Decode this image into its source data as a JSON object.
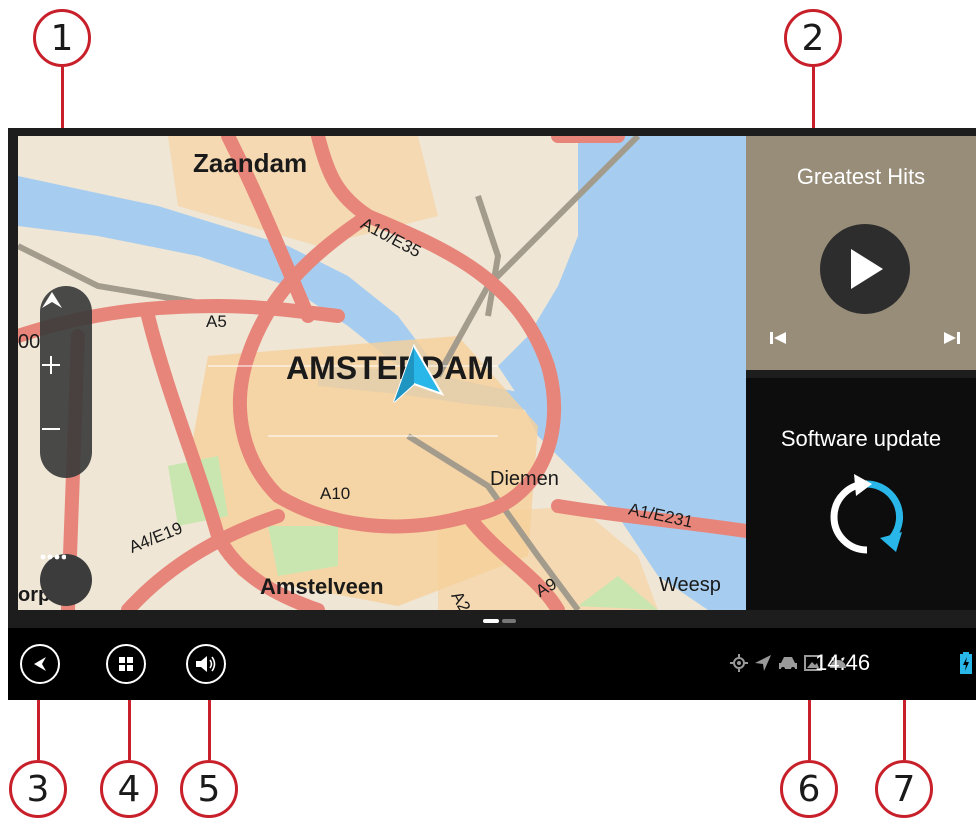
{
  "callouts": [
    "1",
    "2",
    "3",
    "4",
    "5",
    "6",
    "7"
  ],
  "map": {
    "cities": [
      "Zaandam",
      "AMSTERDAM",
      "Diemen",
      "Amstelveen",
      "Weesp",
      "orp",
      "00"
    ],
    "roads": [
      "A10/E35",
      "A5",
      "A10",
      "A4/E19",
      "A1/E231",
      "A9",
      "A2"
    ]
  },
  "music_panel": {
    "title": "Greatest Hits"
  },
  "update_panel": {
    "title": "Software update"
  },
  "status_bar": {
    "time": "14:46"
  },
  "colors": {
    "callout": "#c8202a",
    "route": "#e8857a",
    "water": "#a6cdef",
    "accent": "#29b6e8"
  },
  "icons": [
    "back-icon",
    "apps-grid-icon",
    "volume-icon",
    "location-icon",
    "navigation-arrow-icon",
    "car-icon",
    "image-icon",
    "android-icon",
    "battery-icon",
    "play-icon",
    "previous-track-icon",
    "next-track-icon",
    "sync-icon",
    "pan-up-icon"
  ]
}
